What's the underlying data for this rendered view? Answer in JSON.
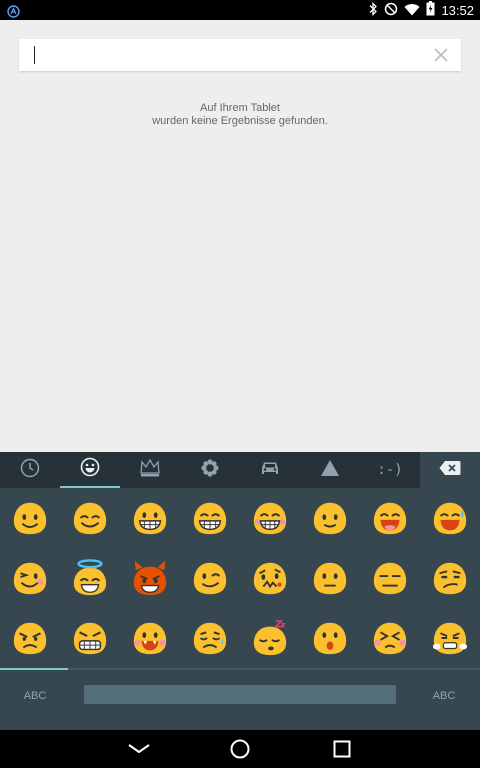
{
  "status_bar": {
    "time": "13:52",
    "icons": [
      "bluetooth-icon",
      "do-not-disturb-icon",
      "wifi-icon",
      "battery-icon"
    ],
    "left_icon": "app-notification-icon"
  },
  "search": {
    "value": "",
    "placeholder": "",
    "clear_icon": "close-icon"
  },
  "empty_message": {
    "line1": "Auf Ihrem Tablet",
    "line2": "wurden keine Ergebnisse gefunden."
  },
  "keyboard": {
    "tabs": [
      {
        "name": "recent-tab",
        "icon": "clock-icon"
      },
      {
        "name": "smileys-tab",
        "icon": "smiley-icon",
        "active": true
      },
      {
        "name": "objects-tab",
        "icon": "crown-icon"
      },
      {
        "name": "nature-tab",
        "icon": "flower-icon"
      },
      {
        "name": "places-tab",
        "icon": "car-icon"
      },
      {
        "name": "symbols-tab",
        "icon": "triangle-icon"
      },
      {
        "name": "emoticons-tab",
        "label": ":-)"
      }
    ],
    "delete_icon": "backspace-icon",
    "abc_left": "ABC",
    "abc_right": "ABC",
    "emojis": [
      "smile",
      "blush-grin",
      "grin-teeth",
      "grin-squint",
      "beaming-grin",
      "slight-smile",
      "laughing",
      "sweat-smile",
      "wink",
      "halo",
      "devil",
      "smirk-wink",
      "cheeky",
      "neutral-smirk",
      "expressionless",
      "unamused",
      "angry",
      "grimace",
      "fangs",
      "sad-weary",
      "sleepy",
      "surprised",
      "squint-pout",
      "crying-steam"
    ],
    "colors": {
      "accent": "#80cbc4",
      "emoji_yellow": "#fbc02d",
      "devil_orange": "#e65100"
    }
  },
  "nav_bar": {
    "back": "back-icon",
    "home": "home-icon",
    "recents": "recents-icon"
  }
}
